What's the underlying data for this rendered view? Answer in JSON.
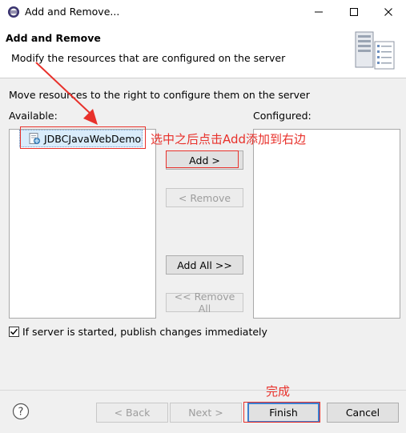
{
  "window": {
    "title": "Add and Remove..."
  },
  "header": {
    "title": "Add and Remove",
    "description": "Modify the resources that are configured on the server"
  },
  "main": {
    "instructions": "Move resources to the right to configure them on the server",
    "available_label": "Available:",
    "configured_label": "Configured:",
    "available_items": [
      {
        "label": "JDBCJavaWebDemo",
        "selected": true
      }
    ],
    "configured_items": []
  },
  "buttons": {
    "add": "Add >",
    "remove": "< Remove",
    "add_all": "Add All >>",
    "remove_all": "<< Remove All"
  },
  "option": {
    "label": "If server is started, publish changes immediately",
    "checked": true
  },
  "footer": {
    "back": "< Back",
    "next": "Next >",
    "finish": "Finish",
    "cancel": "Cancel"
  },
  "annotations": {
    "main_note": "选中之后点击Add添加到右边",
    "finish_note": "完成",
    "color": "#e8312b"
  },
  "colors": {
    "selection": "#d9ecfb",
    "default_button_border": "#3c7fd0"
  }
}
